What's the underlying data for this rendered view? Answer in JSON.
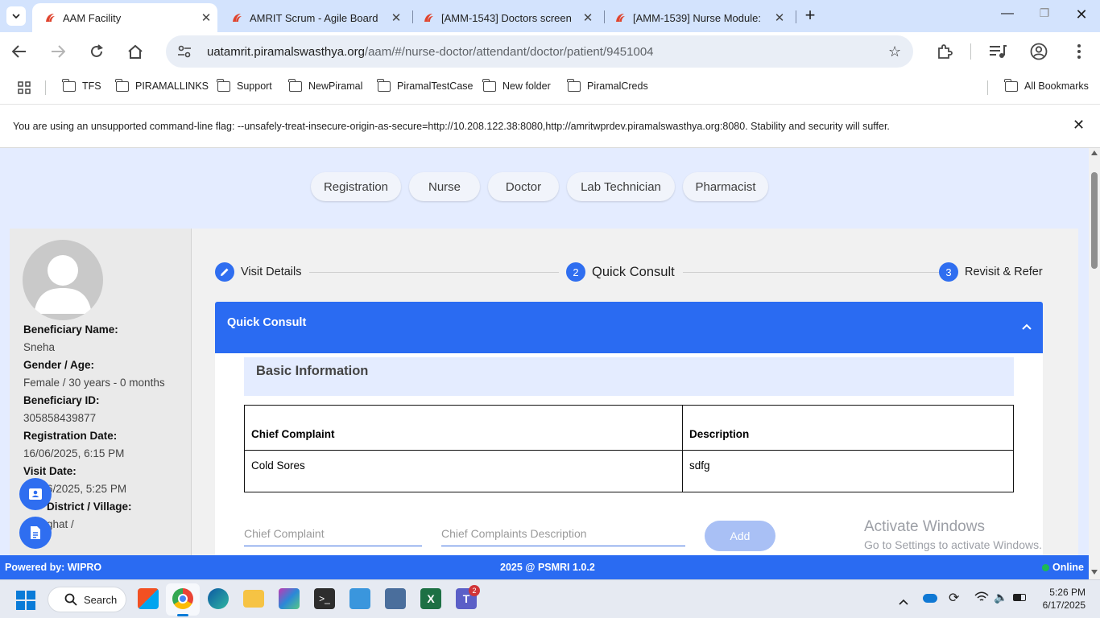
{
  "browser": {
    "tabs": [
      {
        "title": "AAM Facility",
        "active": true
      },
      {
        "title": "AMRIT Scrum - Agile Board",
        "active": false
      },
      {
        "title": "[AMM-1543] Doctors screen",
        "active": false
      },
      {
        "title": "[AMM-1539] Nurse Module:",
        "active": false
      }
    ],
    "url_host": "uatamrit.piramalswasthya.org",
    "url_path": "/aam/#/nurse-doctor/attendant/doctor/patient/9451004",
    "bookmarks": [
      "TFS",
      "PIRAMALLINKS",
      "Support",
      "NewPiramal",
      "PiramalTestCase",
      "New folder",
      "PiramalCreds"
    ],
    "all_bookmarks": "All Bookmarks",
    "infobar": "You are using an unsupported command-line flag: --unsafely-treat-insecure-origin-as-secure=http://10.208.122.38:8080,http://amritwprdev.piramalswasthya.org:8080. Stability and security will suffer."
  },
  "roles": [
    "Registration",
    "Nurse",
    "Doctor",
    "Lab Technician",
    "Pharmacist"
  ],
  "beneficiary": {
    "name_label": "Beneficiary Name:",
    "name": "Sneha",
    "gender_label": "Gender / Age:",
    "gender": "Female / 30 years - 0 months",
    "id_label": "Beneficiary ID:",
    "id": "305858439877",
    "reg_label": "Registration Date:",
    "reg_date": "16/06/2025, 6:15 PM",
    "visit_label": "Visit Date:",
    "visit_date": "6/2025, 5:25 PM",
    "district_label": "District / Village:",
    "district": "ghat /"
  },
  "stepper": {
    "step1": "Visit Details",
    "step2_num": "2",
    "step2": "Quick Consult",
    "step3_num": "3",
    "step3": "Revisit & Refer"
  },
  "quick_consult": {
    "title": "Quick Consult",
    "section": "Basic Information",
    "table_headers": [
      "Chief Complaint",
      "Description"
    ],
    "rows": [
      [
        "Cold Sores",
        "sdfg"
      ]
    ],
    "complaint_placeholder": "Chief Complaint",
    "description_placeholder": "Chief Complaints Description",
    "add_label": "Add"
  },
  "watermark": {
    "line1": "Activate Windows",
    "line2": "Go to Settings to activate Windows."
  },
  "footer": {
    "left": "Powered by: WIPRO",
    "center": "2025 @ PSMRI 1.0.2",
    "right": "Online"
  },
  "taskbar": {
    "search": "Search",
    "time": "5:26 PM",
    "date": "6/17/2025",
    "teams_badge": "2"
  },
  "colors": {
    "primary": "#2a6bf2",
    "page_bg": "#e4ecff",
    "online": "#1db954"
  }
}
